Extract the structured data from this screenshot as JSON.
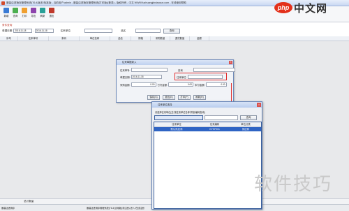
{
  "window": {
    "title": "服装店进销存管理系统(T6.4)版本/标准版 - 当前用户:admin - 服装店进销存管理系统(打印版)(登录) - 版权所有 - 中文 WWW.fuzhuangjinxiaocun.com - 在线使用帮助"
  },
  "toolbar": {
    "items": [
      {
        "label": "新增",
        "icon": "new-doc-icon",
        "color": "#3a7bd5"
      },
      {
        "label": "查询",
        "icon": "search-icon",
        "color": "#4caf50"
      },
      {
        "label": "打印",
        "icon": "print-icon",
        "color": "#f0a030"
      },
      {
        "label": "导出",
        "icon": "export-icon",
        "color": "#8e44ad"
      },
      {
        "label": "刷新",
        "icon": "refresh-icon",
        "color": "#2aa198"
      },
      {
        "label": "退出",
        "icon": "exit-icon",
        "color": "#c0392b"
      }
    ]
  },
  "section": {
    "label": "条件查询"
  },
  "filters": {
    "date_label": "单据日期",
    "date_from": "2016-11-18",
    "date_to": "2016-11-18",
    "supplier_label": "往来单位",
    "supplier_value": "",
    "product_label": "品名",
    "product_value": "",
    "query_button": "查询"
  },
  "grid": {
    "columns": [
      "序号",
      "往来单号",
      "条码",
      "单位名称",
      "品名",
      "规格",
      "采购数量",
      "退货数量",
      "金额"
    ]
  },
  "summary": {
    "label": "总计数量"
  },
  "status": {
    "left": "服装店进销存",
    "mid": "服装店进销存管理系统(T6.4)试用版(未注册)-进入:在线注册",
    "right": "日期:2016-11-18",
    "far": "版本"
  },
  "dialog1": {
    "title": "往来单据录入",
    "order_no_label": "往来单号:",
    "order_no_value": "",
    "date_label": "单据日期:",
    "date_value": "2016-11-18",
    "supplier_label": "往来单位:",
    "supplier_value": "",
    "amount_label": "采购金额:",
    "amount_value": "0.00",
    "paid_label": "已付金额:",
    "paid_value": "0.00",
    "unpaid_label": "未付金额:",
    "unpaid_value": "0.00",
    "search_label": "查询",
    "search_value": "",
    "buttons": [
      "保存(S)",
      "退出(E)",
      "打印(P)",
      "刷新(R)"
    ]
  },
  "dialog2": {
    "title": "往来单位选择",
    "hint": "请选择往来单位(注:按往来单位名称/拼音/编码查询)",
    "search_button": "查询",
    "select_value": "",
    "search_value": "",
    "columns": [
      "往来单位",
      "往来编码",
      "单位分类"
    ],
    "rows": [
      [
        "默认供应商",
        "GYSF001",
        "供应商"
      ]
    ]
  },
  "watermarks": {
    "php": "php",
    "php_cn": "中文网",
    "rjjq": "软件技巧"
  }
}
